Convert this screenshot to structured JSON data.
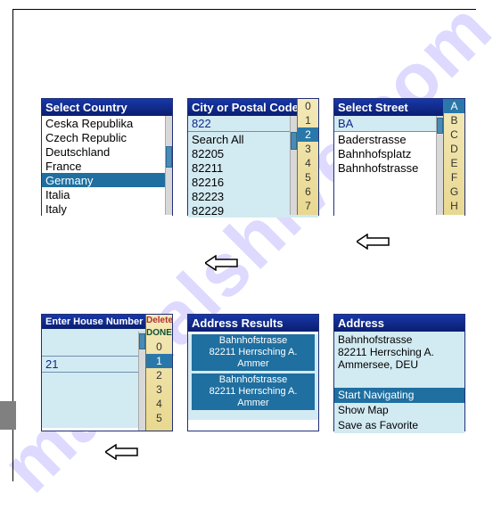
{
  "watermark": "manualshive.com",
  "panels": {
    "country": {
      "title": "Select Country",
      "items": [
        "Ceska Republika",
        "Czech Republic",
        "Deutschland",
        "France",
        "Germany",
        "Italia",
        "Italy"
      ],
      "selectedIndex": 4
    },
    "city": {
      "title": "City or Postal Code",
      "input": "822",
      "items": [
        "Search All",
        "82205",
        "82211",
        "82216",
        "82223",
        "82229"
      ],
      "side": [
        "0",
        "1",
        "2",
        "3",
        "4",
        "5",
        "6",
        "7"
      ],
      "sideSelectedIndex": 2
    },
    "street": {
      "title": "Select Street",
      "input": "BA",
      "items": [
        "Baderstrasse",
        "Bahnhofsplatz",
        "Bahnhofstrasse"
      ],
      "side": [
        "A",
        "B",
        "C",
        "D",
        "E",
        "F",
        "G",
        "H"
      ],
      "sideSelectedIndex": 0
    },
    "house": {
      "title": "Enter House Number",
      "input": "21",
      "side": [
        "Delete",
        "DONE",
        "0",
        "1",
        "2",
        "3",
        "4",
        "5"
      ],
      "sideSelectedIndex": 3
    },
    "results": {
      "title": "Address Results",
      "items": [
        {
          "l1": "Bahnhofstrasse",
          "l2": "82211 Herrsching A. Ammer"
        },
        {
          "l1": "Bahnhofstrasse",
          "l2": "82211 Herrsching A. Ammer"
        }
      ]
    },
    "address": {
      "title": "Address",
      "lines": [
        "Bahnhofstrasse",
        "82211 Herrsching A.",
        "Ammersee, DEU"
      ],
      "actions": [
        "Start Navigating",
        "Show Map",
        "Save as Favorite"
      ],
      "actionSelectedIndex": 0
    }
  }
}
